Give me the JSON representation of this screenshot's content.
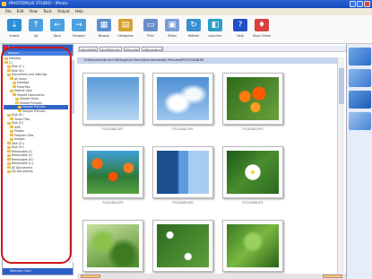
{
  "window": {
    "title": "IPHOTOPLUS STUDIO - iPhoto"
  },
  "menu": [
    "File",
    "Edit",
    "View",
    "Tools",
    "Output",
    "Help"
  ],
  "toolbar": [
    {
      "label": "Import",
      "icon": "import-icon",
      "color": "#2a8fd8"
    },
    {
      "label": "Up",
      "icon": "up-arrow-icon",
      "color": "#4aa0e0"
    },
    {
      "label": "Back",
      "icon": "back-arrow-icon",
      "color": "#4aa0e0"
    },
    {
      "label": "Forward",
      "icon": "forward-arrow-icon",
      "color": "#4aa0e0"
    },
    {
      "label": "Browse",
      "icon": "browse-icon",
      "color": "#5a8fd0"
    },
    {
      "label": "Categorize",
      "icon": "categorize-icon",
      "color": "#d8a030"
    },
    {
      "label": "Print",
      "icon": "print-icon",
      "color": "#6a8fc8"
    },
    {
      "label": "Slides",
      "icon": "slideshow-icon",
      "color": "#7a9ed8"
    },
    {
      "label": "Refresh",
      "icon": "refresh-icon",
      "color": "#3a8fd0"
    },
    {
      "label": "Launcher",
      "icon": "launcher-icon",
      "color": "#2aa0c8"
    },
    {
      "label": "Help",
      "icon": "help-icon",
      "color": "#2050c8"
    },
    {
      "label": "Shop Online",
      "icon": "shop-online-icon",
      "color": "#d84040"
    }
  ],
  "left_panel": {
    "header": "Folders",
    "subheader": "Explorer",
    "tree": [
      "Desktop",
      "C:\\",
      "Disk (C:)",
      "Disk (D:)",
      "Documents and Settings",
      "All Users",
      "Desktop",
      "Favorites",
      "Default User",
      "Shared Documents",
      "Shared Music",
      "Shared Pictures",
      "Sample Pictures",
      "Sample Pictures",
      "Disk (E:)",
      "Share Files",
      "Disk (F:)",
      "USB",
      "Photos",
      "Program Files",
      "Images",
      "Disk (G:)",
      "Disk (H:)",
      "Removable (I:)",
      "Removable (J:)",
      "Removable (K:)",
      "Removable (L:)",
      "All Documents",
      "My Documents"
    ],
    "selected_index": 12,
    "bottom_label": "Memory Card"
  },
  "pathbar": {
    "view_label": "View Details",
    "sort_label": "Sort Name Asc",
    "size_label": "Size Large",
    "filter_label": "Date range All"
  },
  "path_display": "D:\\Documents and Settings\\All Users\\Documents\\My Pictures\\PHOTOALBUM",
  "thumbnails": [
    {
      "caption": "P1010001.JPG",
      "kind": "sky-blue"
    },
    {
      "caption": "P1010002.JPG",
      "kind": "sky-clouds"
    },
    {
      "caption": "P1010003.JPG",
      "kind": "orange-flowers"
    },
    {
      "caption": "P1010004.JPG",
      "kind": "orange-red-flowers"
    },
    {
      "caption": "P1010005.JPG",
      "kind": "building"
    },
    {
      "caption": "P1010006.JPG",
      "kind": "white-flower"
    },
    {
      "caption": "P1010007.JPG",
      "kind": "green-foliage"
    },
    {
      "caption": "P1010008.JPG",
      "kind": "white-daisies"
    },
    {
      "caption": "P1010009.JPG",
      "kind": "green-leaves"
    }
  ]
}
